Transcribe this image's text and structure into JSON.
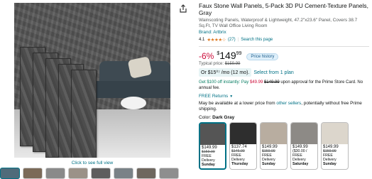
{
  "gallery": {
    "zoom_caption": "Click to see full view",
    "thumb_count": 8
  },
  "product": {
    "title": "Faux Stone Wall Panels, 5-Pack 3D PU Cement-Texture Panels, Gray",
    "subtitle": "Wainscoting Panels, Waterproof & Lightweight, 47.2\"x23.6\" Panel, Covers 38.7 Sq.Ft, TV Wall Office Living Room",
    "brand": "Brand: Artbrix",
    "rating": "4.1",
    "stars": "★★★★☆",
    "review_count": "(27)",
    "search_link": "Search this page",
    "discount": "-6%",
    "price_symbol": "$",
    "price_whole": "149",
    "price_cents": "99",
    "price_history_label": "Price history",
    "typical_label": "Typical price:",
    "typical_price": "$159.99",
    "sub_or": "Or",
    "sub_price": "$15⁰⁷ /mo (12 mo).",
    "sub_link": "Select from 1 plan",
    "promo_text": "Get $100 off instantly: Pay",
    "promo_new": "$49.99",
    "promo_old": "$149.99",
    "promo_rest": "upon approval for the Prime Store Card. No annual fee.",
    "returns": "FREE Returns",
    "avail_text": "May be available at a lower price from",
    "avail_link": "other sellers",
    "avail_rest": ", potentially without free Prime shipping.",
    "color_label": "Color:",
    "color_value": "Dark Gray",
    "swatches": [
      {
        "price": "$149.99",
        "was": "$159.99",
        "ship": "FREE Delivery",
        "day": "Sunday"
      },
      {
        "price": "$137.74",
        "was": "$146.99",
        "ship": "FREE Delivery",
        "day": "Thursday"
      },
      {
        "price": "$149.99",
        "was": "$159.99",
        "ship": "FREE Delivery",
        "day": "Sunday"
      },
      {
        "price": "$149.99",
        "was": "($30.00 /",
        "ship": "FREE Delivery",
        "day": "Saturday"
      },
      {
        "price": "$149.99",
        "was": "$159.99",
        "ship": "FREE Delivery",
        "day": "Sunday"
      }
    ]
  }
}
